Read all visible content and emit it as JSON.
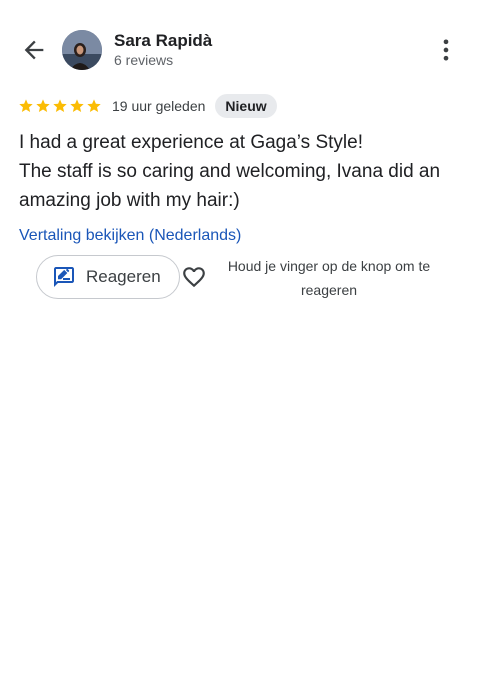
{
  "header": {
    "back_icon": "arrow-left-icon",
    "user_name": "Sara Rapidà",
    "review_count": "6 reviews",
    "more_icon": "more-vert-icon"
  },
  "review": {
    "rating": 5,
    "max_rating": 5,
    "star_color": "#FBBC04",
    "time_ago": "19 uur geleden",
    "badge": "Nieuw",
    "text": "I had a great experience at Gaga’s Style!\nThe staff is so caring and welcoming, Ivana did an amazing job with my hair:)",
    "translate_link": "Vertaling bekijken (Nederlands)"
  },
  "actions": {
    "reply_label": "Reageren",
    "reply_icon": "rate-review-icon",
    "heart_icon": "heart-outline-icon",
    "hint": "Houd je vinger op de knop om te reageren"
  },
  "colors": {
    "accent_blue": "#1A56B8",
    "text_primary": "#202124",
    "text_secondary": "#5F6368"
  }
}
